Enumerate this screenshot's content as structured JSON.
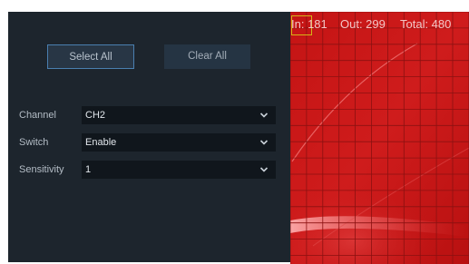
{
  "actions": {
    "select_all_label": "Select All",
    "clear_all_label": "Clear All"
  },
  "settings": {
    "channel": {
      "label": "Channel",
      "value": "CH2"
    },
    "switch": {
      "label": "Switch",
      "value": "Enable"
    },
    "sensitivity": {
      "label": "Sensitivity",
      "value": "1"
    }
  },
  "preview": {
    "count_in": "In: 181",
    "count_out": "Out: 299",
    "count_total": "Total: 480",
    "overlay_color": "#cc1a1a",
    "grid_color": "#8b1111"
  },
  "colors": {
    "panel_background": "#1d252d",
    "accent_border": "#4a7fb0",
    "marker": "#d5b417"
  },
  "icons": {
    "dropdown": "chevron-down-icon"
  }
}
